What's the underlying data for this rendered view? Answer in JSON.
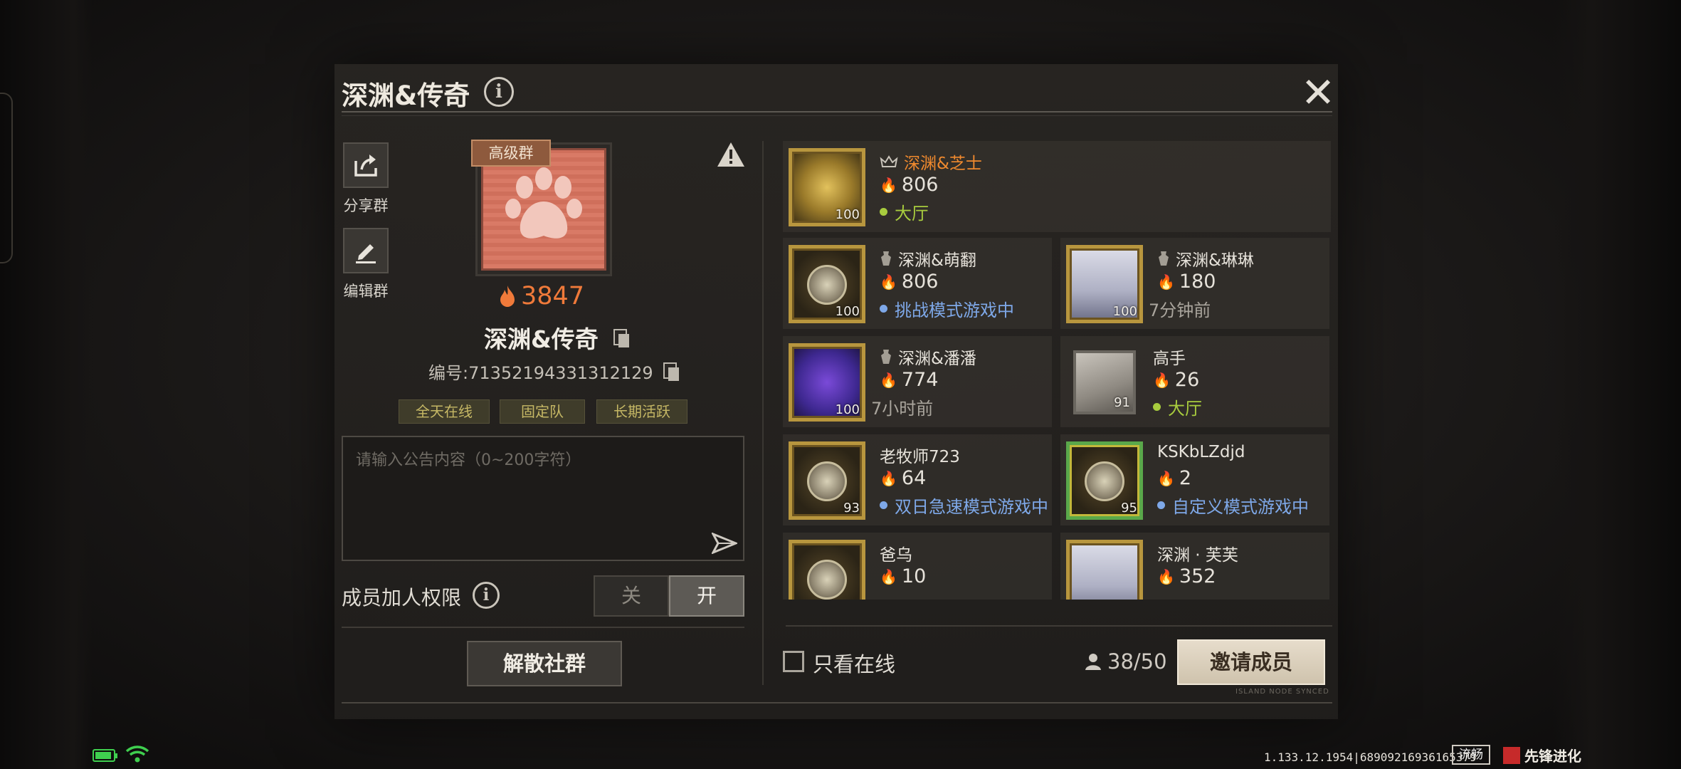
{
  "header": {
    "title": "深渊&传奇"
  },
  "side": {
    "share_label": "分享群",
    "edit_label": "编辑群"
  },
  "group": {
    "badge": "高级群",
    "heat": "3847",
    "name": "深渊&传奇",
    "id_text": "编号:71352194331312129",
    "tags": [
      "全天在线",
      "固定队",
      "长期活跃"
    ]
  },
  "notice": {
    "placeholder": "请输入公告内容（0~200字符）"
  },
  "permission": {
    "label": "成员加人权限",
    "off": "关",
    "on": "开",
    "selected": "开"
  },
  "disband_label": "解散社群",
  "members": [
    {
      "name": "深渊&芝士",
      "heat": "806",
      "status": "大厅",
      "status_type": "lobby",
      "level": "100",
      "role": "owner"
    },
    {
      "name": "深渊&萌翻",
      "heat": "806",
      "status": "挑战模式游戏中",
      "status_type": "game",
      "level": "100",
      "role": "admin"
    },
    {
      "name": "深渊&琳琳",
      "heat": "180",
      "status": "7分钟前",
      "status_type": "time",
      "level": "100",
      "role": "admin"
    },
    {
      "name": "深渊&潘潘",
      "heat": "774",
      "status": "7小时前",
      "status_type": "time",
      "level": "100",
      "role": "admin"
    },
    {
      "name": "高手",
      "heat": "26",
      "status": "大厅",
      "status_type": "lobby",
      "level": "91",
      "role": "member"
    },
    {
      "name": "老牧师723",
      "heat": "64",
      "status": "双日急速模式游戏中",
      "status_type": "game",
      "level": "93",
      "role": "member"
    },
    {
      "name": "KSKbLZdjd",
      "heat": "2",
      "status": "自定义模式游戏中",
      "status_type": "game",
      "level": "95",
      "role": "member"
    },
    {
      "name": "爸乌",
      "heat": "10",
      "status": "",
      "status_type": "none",
      "level": "",
      "role": "member"
    },
    {
      "name": "深渊 · 芙芙",
      "heat": "352",
      "status": "",
      "status_type": "none",
      "level": "",
      "role": "member"
    }
  ],
  "footer": {
    "online_only_label": "只看在线",
    "online_only_checked": false,
    "member_count": "38/50",
    "invite_label": "邀请成员",
    "tiny_text": "ISLAND NODE SYNCED"
  },
  "statusbar": {
    "version": "1.133.12.1954|68909216936165379",
    "quality": "流畅",
    "brand": "先锋进化"
  },
  "colors": {
    "accent_orange": "#f07a3a",
    "lobby_green": "#a8cc3e",
    "in_game_blue": "#7ea8e8",
    "tag_gold": "#c6b865"
  },
  "icons": [
    "info-icon",
    "close-icon",
    "share-icon",
    "edit-icon",
    "warning-icon",
    "paw-icon",
    "fire-icon",
    "copy-icon",
    "send-icon",
    "crown-icon",
    "rank-icon",
    "person-icon",
    "battery-icon",
    "wifi-icon"
  ]
}
